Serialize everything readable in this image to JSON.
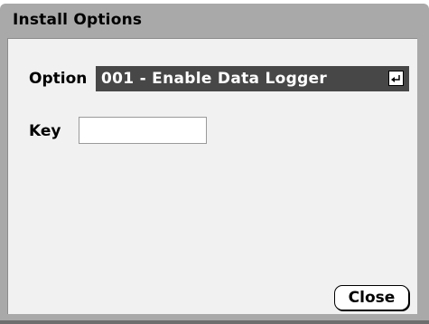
{
  "dialog": {
    "title": "Install Options"
  },
  "form": {
    "option_label": "Option",
    "option_value": "001 - Enable Data Logger",
    "option_icon": "enter-icon",
    "key_label": "Key",
    "key_value": ""
  },
  "buttons": {
    "close_label": "Close"
  },
  "colors": {
    "frame": "#a9a9a9",
    "panel": "#f1f1f1",
    "selected_field": "#474747",
    "selected_text": "#ffffff"
  }
}
